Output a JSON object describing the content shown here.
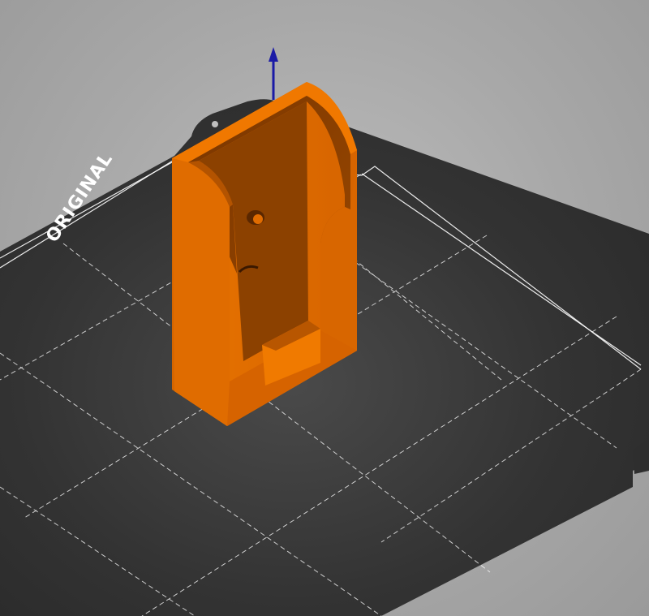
{
  "viewport": {
    "background": "#a6a6a6"
  },
  "bed": {
    "logo_text": "ORIGINAL",
    "surface_color": "#3b3b3b",
    "grid_color": "#ffffff"
  },
  "model": {
    "color": "#e06a00",
    "shade_color": "#8a3d00"
  },
  "axis_gizmo": {
    "color": "#1a1aa6",
    "icon": "z-axis-arrow-icon"
  }
}
